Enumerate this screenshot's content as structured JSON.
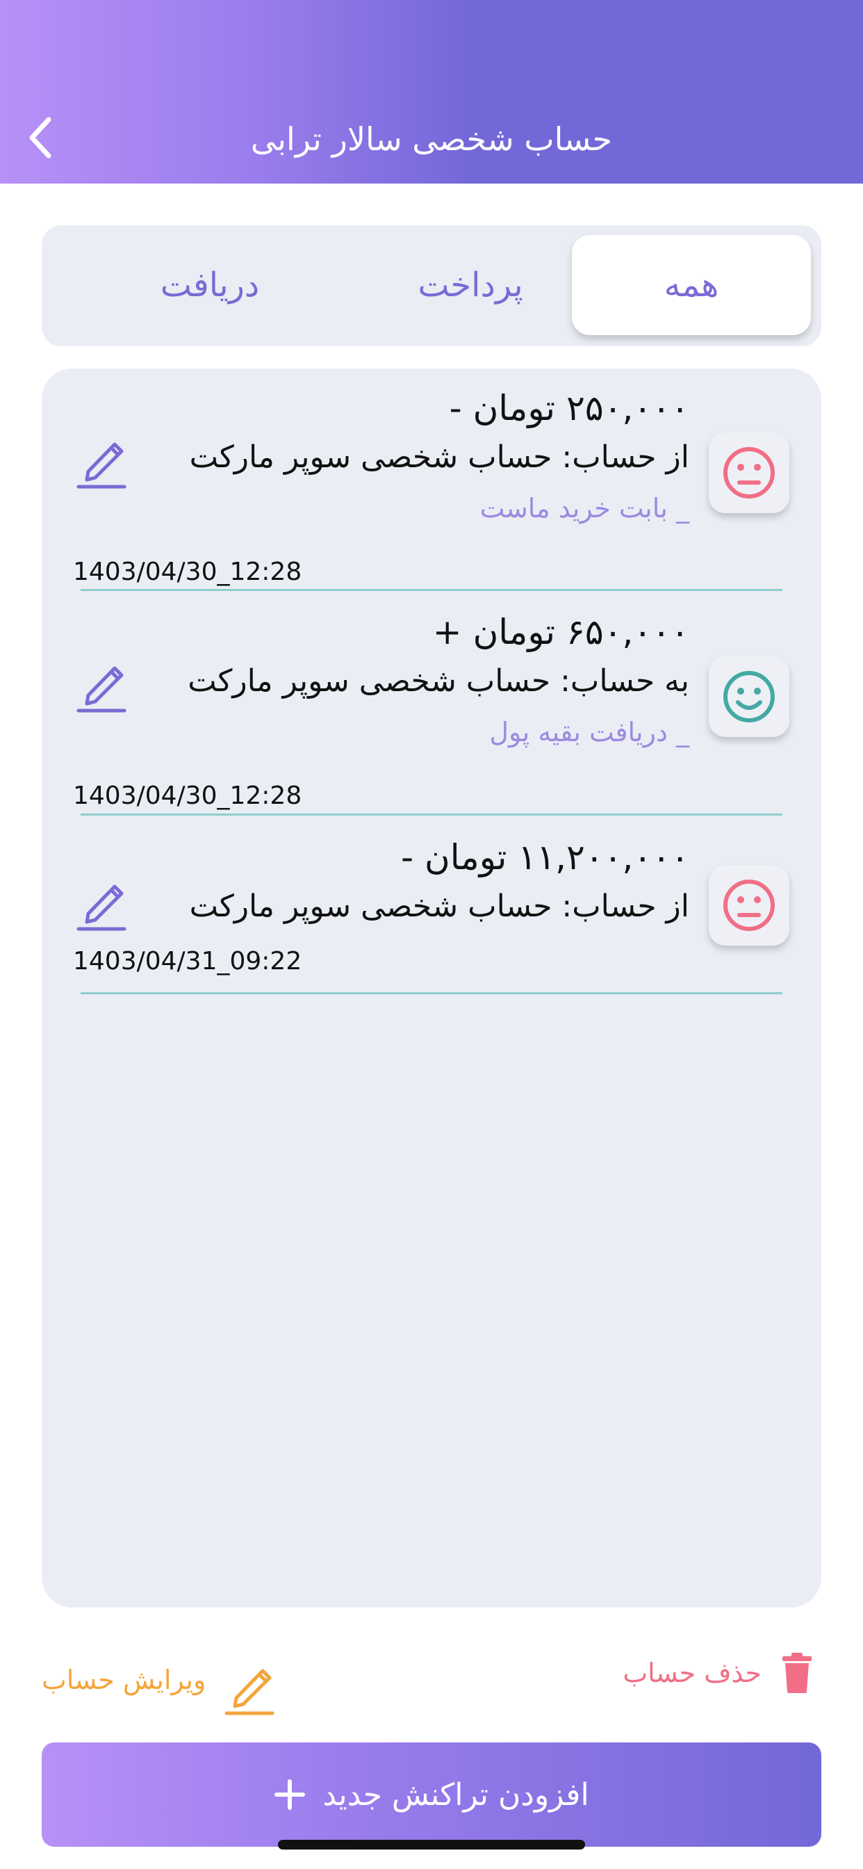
{
  "header": {
    "title": "حساب شخصی سالار ترابی",
    "back_icon": "chevron-left-icon"
  },
  "tabs": [
    {
      "label": "همه",
      "active": true
    },
    {
      "label": "پرداخت",
      "active": false
    },
    {
      "label": "دریافت",
      "active": false
    }
  ],
  "transactions": [
    {
      "amount": "۲۵۰,۰۰۰ تومان -",
      "account": "از حساب:  حساب شخصی سوپر مارکت",
      "note": "_ بابت خرید ماست",
      "date": "1403/04/30_12:28",
      "mood": "neutral-face-icon",
      "mood_color": "#f06f86"
    },
    {
      "amount": "۶۵۰,۰۰۰ تومان +",
      "account": "به حساب:  حساب شخصی سوپر مارکت",
      "note": "_ دریافت بقیه پول",
      "date": "1403/04/30_12:28",
      "mood": "smile-face-icon",
      "mood_color": "#45a9a3"
    },
    {
      "amount": "۱۱,۲۰۰,۰۰۰ تومان -",
      "account": "از حساب:  حساب شخصی سوپر مارکت",
      "note": "",
      "date": "1403/04/31_09:22",
      "mood": "neutral-face-icon",
      "mood_color": "#f06f86"
    }
  ],
  "actions": {
    "edit_account": "ویرایش حساب",
    "delete_account": "حذف حساب",
    "add_transaction": "افزودن تراکنش جدید"
  },
  "colors": {
    "accent": "#7368d8",
    "accent_light": "#b691f7",
    "edit_orange": "#f3a53b",
    "delete_pink": "#f06f86",
    "divider_teal": "#8fcfcc"
  }
}
